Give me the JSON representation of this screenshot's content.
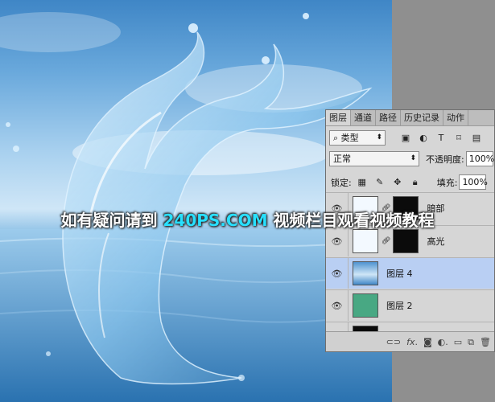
{
  "panel": {
    "tabs": [
      "图层",
      "通道",
      "路径",
      "历史记录",
      "动作"
    ],
    "filter_label": "类型",
    "blend_mode": "正常",
    "opacity_label": "不透明度:",
    "opacity_value": "100%",
    "lock_label": "锁定:",
    "fill_label": "填充:",
    "fill_value": "100%",
    "layers": [
      {
        "name": "暗部"
      },
      {
        "name": "高光"
      },
      {
        "name": "图层 4"
      },
      {
        "name": "图层 2"
      },
      {
        "name": ""
      }
    ],
    "footer_icons": [
      "link-icon",
      "fx-icon",
      "mask-icon",
      "adjustment-icon",
      "group-icon",
      "new-layer-icon",
      "trash-icon"
    ]
  },
  "watermark": {
    "prefix": "如有疑问请到 ",
    "site": "240PS.COM",
    "suffix": " 视频栏目观看视频教程"
  },
  "colors": {
    "selected_layer": "#b9cff3",
    "layer2_fill": "#48a883",
    "watermark_site": "#28e0ff"
  }
}
